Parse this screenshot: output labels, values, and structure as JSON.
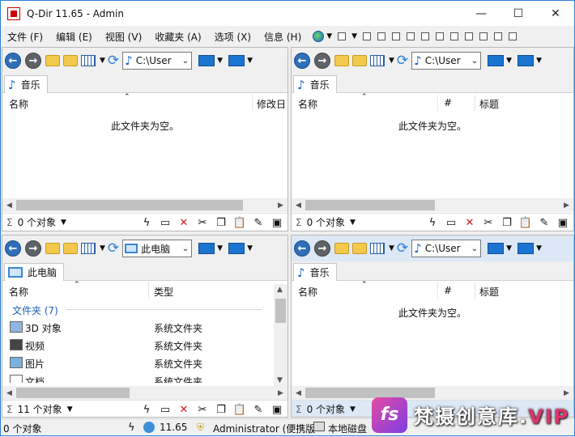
{
  "window": {
    "title": "Q-Dir 11.65 - Admin",
    "minimize": "—",
    "maximize": "☐",
    "close": "✕"
  },
  "menu": [
    "文件 (F)",
    "编辑 (E)",
    "视图 (V)",
    "收藏夹 (A)",
    "选项 (X)",
    "信息 (H)"
  ],
  "panes": {
    "tl": {
      "address": "C:\\User",
      "tab": "音乐",
      "col1": "名称",
      "col2": "",
      "col3": "修改日",
      "empty": "此文件夹为空。",
      "count": "0 个对象"
    },
    "tr": {
      "address": "C:\\User",
      "tab": "音乐",
      "col1": "名称",
      "col2": "#",
      "col3": "标题",
      "empty": "此文件夹为空。",
      "count": "0 个对象"
    },
    "bl": {
      "address": "此电脑",
      "tab": "此电脑",
      "col1": "名称",
      "col2": "类型",
      "group": "文件夹 (7)",
      "count": "11 个对象",
      "rows": [
        {
          "name": "3D 对象",
          "type": "系统文件夹"
        },
        {
          "name": "视频",
          "type": "系统文件夹"
        },
        {
          "name": "图片",
          "type": "系统文件夹"
        },
        {
          "name": "文档",
          "type": "系统文件夹"
        }
      ]
    },
    "br": {
      "address": "C:\\User",
      "tab": "音乐",
      "col1": "名称",
      "col2": "#",
      "col3": "标题",
      "empty": "此文件夹为空。",
      "count": "0 个对象"
    }
  },
  "statusbar": {
    "objects": "0 个对象",
    "version": "11.65",
    "user": "Administrator (便携版",
    "disk": "本地磁盘"
  },
  "watermark": {
    "logo": "fs",
    "text": "梵摄创意库.",
    "vip": "VIP"
  },
  "icons": [
    "back-arrow-icon",
    "forward-arrow-icon",
    "up-folder-icon",
    "new-folder-icon",
    "view-mode-icon",
    "refresh-icon",
    "music-note-icon",
    "monitor-icon",
    "lightning-icon",
    "rename-icon",
    "delete-x-icon",
    "cut-icon",
    "copy-icon",
    "paste-icon",
    "properties-icon",
    "select-all-icon",
    "globe-icon"
  ]
}
